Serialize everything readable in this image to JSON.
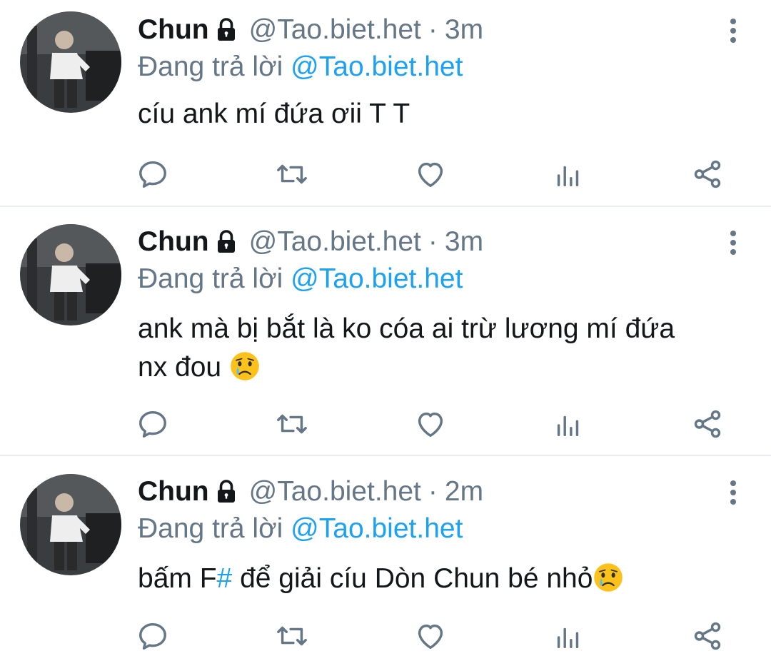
{
  "tweets": [
    {
      "name": "Chun",
      "handle": "@Tao.biet.het",
      "separator": "·",
      "time": "3m",
      "reply_prefix": "Đang trả lời",
      "reply_to": "@Tao.biet.het",
      "text_line1": "cíu ank mí đứa ơii T T",
      "text_line2": ""
    },
    {
      "name": "Chun",
      "handle": "@Tao.biet.het",
      "separator": "·",
      "time": "3m",
      "reply_prefix": "Đang trả lời",
      "reply_to": "@Tao.biet.het",
      "text_line1": "ank mà bị bắt là ko cóa ai trừ lương mí đứa",
      "text_line2": "nx đou",
      "emoji": "crying-face"
    },
    {
      "name": "Chun",
      "handle": "@Tao.biet.het",
      "separator": "·",
      "time": "2m",
      "reply_prefix": "Đang trả lời",
      "reply_to": "@Tao.biet.het",
      "text_before": "bấm F",
      "text_hash": "#",
      "text_after": " để giải cíu Dòn Chun bé nhỏ",
      "emoji": "crying-face"
    }
  ],
  "icons": {
    "lock": "lock-icon",
    "more": "more-vertical-icon",
    "comment": "comment-icon",
    "retweet": "retweet-icon",
    "like": "heart-icon",
    "stats": "analytics-icon",
    "share": "share-icon"
  },
  "colors": {
    "text": "#14171a",
    "secondary": "#657786",
    "link": "#1da1f2",
    "divider": "#e6ecf0"
  }
}
